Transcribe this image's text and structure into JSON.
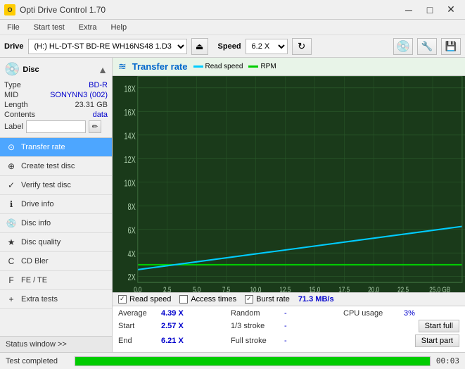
{
  "titlebar": {
    "title": "Opti Drive Control 1.70",
    "icon": "O",
    "min_btn": "─",
    "max_btn": "□",
    "close_btn": "✕"
  },
  "menubar": {
    "items": [
      "File",
      "Start test",
      "Extra",
      "Help"
    ]
  },
  "drivetoolbar": {
    "drive_label": "Drive",
    "drive_value": "(H:) HL-DT-ST BD-RE  WH16NS48 1.D3",
    "speed_label": "Speed",
    "speed_value": "6.2 X"
  },
  "disc": {
    "type_label": "Type",
    "type_value": "BD-R",
    "mid_label": "MID",
    "mid_value": "SONYNN3 (002)",
    "length_label": "Length",
    "length_value": "23.31 GB",
    "contents_label": "Contents",
    "contents_value": "data",
    "label_label": "Label",
    "label_value": ""
  },
  "nav": {
    "items": [
      {
        "id": "transfer-rate",
        "label": "Transfer rate",
        "icon": "⊙",
        "active": true
      },
      {
        "id": "create-test-disc",
        "label": "Create test disc",
        "icon": "⊕"
      },
      {
        "id": "verify-test-disc",
        "label": "Verify test disc",
        "icon": "✓"
      },
      {
        "id": "drive-info",
        "label": "Drive info",
        "icon": "ℹ"
      },
      {
        "id": "disc-info",
        "label": "Disc info",
        "icon": "💿"
      },
      {
        "id": "disc-quality",
        "label": "Disc quality",
        "icon": "★"
      },
      {
        "id": "cd-bler",
        "label": "CD Bler",
        "icon": "C"
      },
      {
        "id": "fe-te",
        "label": "FE / TE",
        "icon": "F"
      },
      {
        "id": "extra-tests",
        "label": "Extra tests",
        "icon": "+"
      }
    ],
    "status_window": "Status window >>"
  },
  "chart": {
    "title": "Transfer rate",
    "legend": [
      {
        "id": "read-speed",
        "label": "Read speed",
        "color": "#00ccff"
      },
      {
        "id": "rpm",
        "label": "RPM",
        "color": "#00cc00"
      }
    ],
    "y_axis": [
      "18X",
      "16X",
      "14X",
      "12X",
      "10X",
      "8X",
      "6X",
      "4X",
      "2X",
      "0.0"
    ],
    "x_axis": [
      "0.0",
      "2.5",
      "5.0",
      "7.5",
      "10.0",
      "12.5",
      "15.0",
      "17.5",
      "20.0",
      "22.5",
      "25.0 GB"
    ],
    "checkboxes": [
      {
        "id": "read-speed-check",
        "label": "Read speed",
        "checked": true
      },
      {
        "id": "access-times-check",
        "label": "Access times",
        "checked": false
      },
      {
        "id": "burst-rate-check",
        "label": "Burst rate",
        "checked": true
      }
    ],
    "burst_value": "71.3 MB/s"
  },
  "stats": {
    "average_label": "Average",
    "average_value": "4.39 X",
    "random_label": "Random",
    "random_value": "-",
    "cpu_label": "CPU usage",
    "cpu_value": "3%",
    "start_label": "Start",
    "start_value": "2.57 X",
    "stroke13_label": "1/3 stroke",
    "stroke13_value": "-",
    "start_full_btn": "Start full",
    "end_label": "End",
    "end_value": "6.21 X",
    "full_stroke_label": "Full stroke",
    "full_stroke_value": "-",
    "start_part_btn": "Start part"
  },
  "statusbar": {
    "text": "Test completed",
    "progress": 100,
    "time": "00:03"
  }
}
